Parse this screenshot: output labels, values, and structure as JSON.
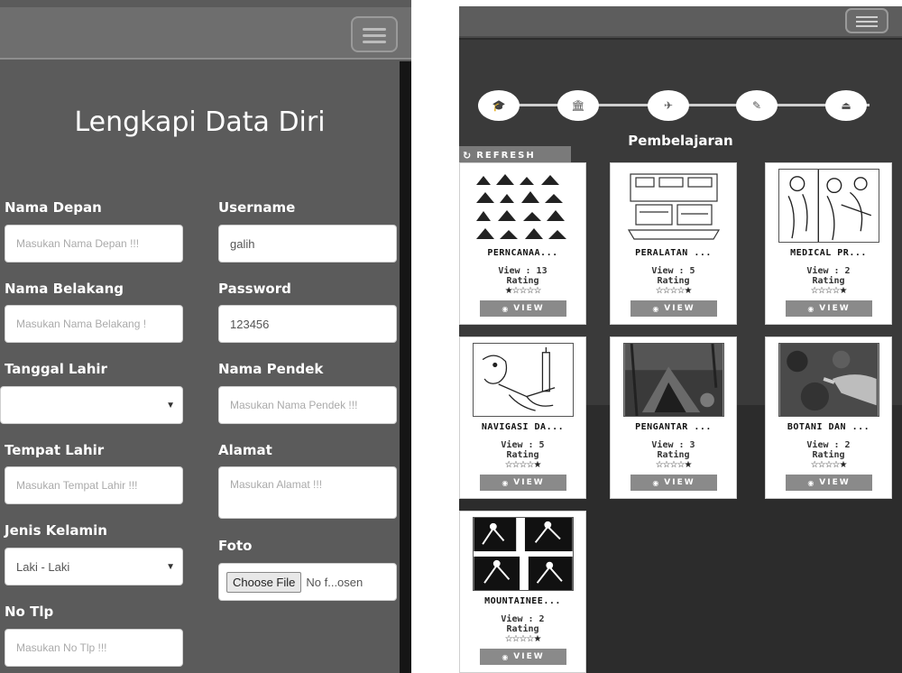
{
  "form_screen": {
    "title": "Lengkapi Data Diri",
    "fields": {
      "nama_depan": {
        "label": "Nama Depan",
        "placeholder": "Masukan Nama Depan !!!"
      },
      "username": {
        "label": "Username",
        "value": "galih"
      },
      "nama_belakang": {
        "label": "Nama Belakang",
        "placeholder": "Masukan Nama Belakang !"
      },
      "password": {
        "label": "Password",
        "value": "123456"
      },
      "tanggal_lahir": {
        "label": "Tanggal Lahir",
        "value": ""
      },
      "nama_pendek": {
        "label": "Nama Pendek",
        "placeholder": "Masukan Nama Pendek !!!"
      },
      "tempat_lahir": {
        "label": "Tempat Lahir",
        "placeholder": "Masukan Tempat Lahir !!!"
      },
      "alamat": {
        "label": "Alamat",
        "placeholder": "Masukan Alamat !!!"
      },
      "jenis_kelamin": {
        "label": "Jenis Kelamin",
        "value": "Laki - Laki"
      },
      "foto": {
        "label": "Foto",
        "button": "Choose File",
        "status": "No f...osen"
      },
      "no_tlp": {
        "label": "No Tlp",
        "placeholder": "Masukan No Tlp !!!"
      }
    },
    "select_arrow": "▼"
  },
  "learning_screen": {
    "section_title": "Pembelajaran",
    "refresh_label": "REFRESH",
    "refresh_icon": "↻",
    "step_icons": [
      "graduation-cap-icon",
      "bank-icon",
      "paper-plane-icon",
      "pencil-icon",
      "eject-icon"
    ],
    "step_glyphs": [
      "🎓",
      "🏛",
      "✈",
      "✎",
      "⏏"
    ],
    "view_button_label": "VIEW",
    "eye_glyph": "◉",
    "cards": [
      {
        "title": "PERNCANAA...",
        "view": "View : 13",
        "rating_label": "Rating",
        "stars": "★☆☆☆☆",
        "rating": 1
      },
      {
        "title": "PERALATAN ...",
        "view": "View : 5",
        "rating_label": "Rating",
        "stars": "☆☆☆☆★",
        "rating": 1
      },
      {
        "title": "MEDICAL PR...",
        "view": "View : 2",
        "rating_label": "Rating",
        "stars": "☆☆☆☆★",
        "rating": 1
      },
      {
        "title": "NAVIGASI DA...",
        "view": "View : 5",
        "rating_label": "Rating",
        "stars": "☆☆☆☆★",
        "rating": 1
      },
      {
        "title": "PENGANTAR ...",
        "view": "View : 3",
        "rating_label": "Rating",
        "stars": "☆☆☆☆★",
        "rating": 1
      },
      {
        "title": "BOTANI DAN ...",
        "view": "View : 2",
        "rating_label": "Rating",
        "stars": "☆☆☆☆★",
        "rating": 1
      },
      {
        "title": "MOUNTAINEE...",
        "view": "View : 2",
        "rating_label": "Rating",
        "stars": "☆☆☆☆★",
        "rating": 1
      }
    ]
  }
}
